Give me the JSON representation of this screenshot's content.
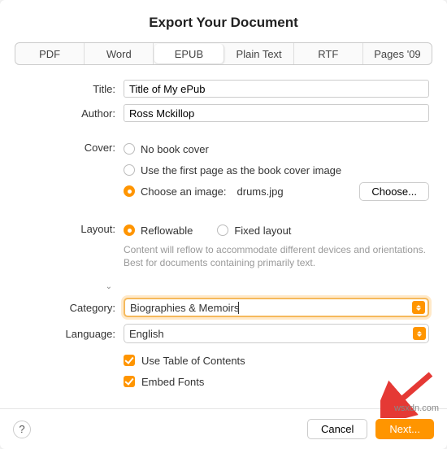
{
  "dialog": {
    "title": "Export Your Document"
  },
  "tabs": [
    "PDF",
    "Word",
    "EPUB",
    "Plain Text",
    "RTF",
    "Pages '09"
  ],
  "active_tab_index": 2,
  "labels": {
    "title": "Title:",
    "author": "Author:",
    "cover": "Cover:",
    "layout": "Layout:",
    "category": "Category:",
    "language": "Language:"
  },
  "fields": {
    "title_value": "Title of My ePub",
    "author_value": "Ross Mckillop",
    "cover_options": {
      "none": "No book cover",
      "first_page": "Use the first page as the book cover image",
      "choose_image": "Choose an image:",
      "image_name": "drums.jpg"
    },
    "choose_button": "Choose...",
    "layout_options": {
      "reflowable": "Reflowable",
      "fixed": "Fixed layout"
    },
    "layout_help": "Content will reflow to accommodate different devices and orientations. Best for documents containing primarily text.",
    "category_value": "Biographies & Memoirs",
    "language_value": "English",
    "use_toc": "Use Table of Contents",
    "embed_fonts": "Embed Fonts"
  },
  "footer": {
    "help": "?",
    "cancel": "Cancel",
    "next": "Next..."
  },
  "watermark": "wsxdn.com"
}
